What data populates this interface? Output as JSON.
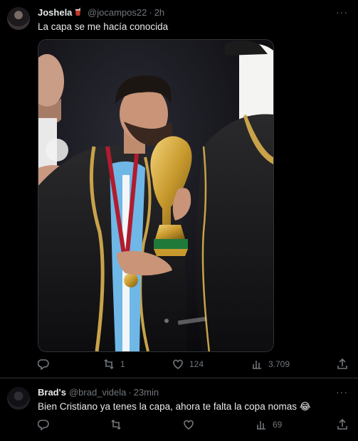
{
  "tweets": [
    {
      "name": "Joshela",
      "handle": "@jocampos22",
      "separator": "·",
      "time": "2h",
      "text": "La capa se me hacía conocida",
      "replies": "",
      "retweets": "1",
      "likes": "124",
      "views": "3.709",
      "name_emoji": "mate-icon",
      "avatar": "avatar-icon",
      "media": "photo"
    },
    {
      "name": "Brad's",
      "handle": "@brad_videla",
      "separator": "·",
      "time": "23min",
      "text": "Bien Cristiano ya tenes la capa, ahora te falta la copa nomas",
      "text_emoji": "😂",
      "replies": "",
      "retweets": "",
      "likes": "",
      "views": "69",
      "avatar": "avatar-icon"
    }
  ],
  "more_label": "···",
  "icons": {
    "reply": "reply-icon",
    "retweet": "retweet-icon",
    "like": "heart-icon",
    "views": "views-icon",
    "share": "share-icon"
  },
  "colors": {
    "background": "#000000",
    "text": "#e7e9ea",
    "secondary": "#71767b",
    "divider": "#2f3336"
  }
}
